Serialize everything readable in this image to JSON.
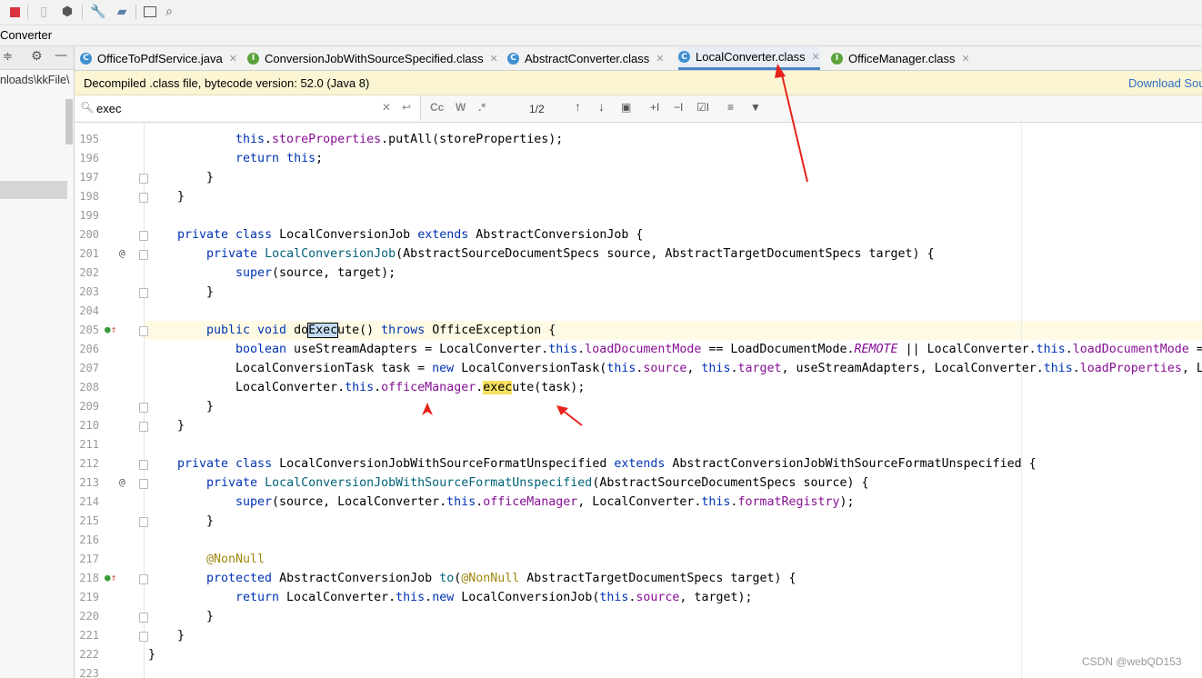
{
  "breadcrumb": "Converter",
  "left_panel": {
    "path_fragment": "nloads\\kkFile\\"
  },
  "tabs": [
    {
      "label": "OfficeToPdfService.java",
      "icon": "C",
      "icon_color": "#3f8fd1",
      "active": false
    },
    {
      "label": "ConversionJobWithSourceSpecified.class",
      "icon": "I",
      "icon_color": "#5aa33a",
      "active": false
    },
    {
      "label": "AbstractConverter.class",
      "icon": "C",
      "icon_color": "#3f8fd1",
      "active": false
    },
    {
      "label": "LocalConverter.class",
      "icon": "C",
      "icon_color": "#3f8fd1",
      "active": true
    },
    {
      "label": "OfficeManager.class",
      "icon": "I",
      "icon_color": "#5aa33a",
      "active": false
    }
  ],
  "banner": {
    "message": "Decompiled .class file, bytecode version: 52.0 (Java 8)",
    "link": "Download Sou"
  },
  "search": {
    "query": "exec",
    "match_count": "1/2",
    "case_label": "Cc",
    "word_label": "W",
    "regex_label": ".*"
  },
  "lines": [
    {
      "n": "195",
      "indent": 3,
      "parts": [
        [
          "kw",
          "this"
        ],
        [
          "",
          "."
        ],
        [
          "fld",
          "storeProperties"
        ],
        [
          "",
          ".putAll(storeProperties);"
        ]
      ]
    },
    {
      "n": "196",
      "indent": 3,
      "parts": [
        [
          "kw",
          "return"
        ],
        [
          "",
          " "
        ],
        [
          "kw",
          "this"
        ],
        [
          "",
          ";"
        ]
      ]
    },
    {
      "n": "197",
      "indent": 2,
      "parts": [
        [
          "",
          "}"
        ]
      ]
    },
    {
      "n": "198",
      "indent": 1,
      "parts": [
        [
          "",
          "}"
        ]
      ]
    },
    {
      "n": "199",
      "indent": 0,
      "parts": []
    },
    {
      "n": "200",
      "indent": 1,
      "parts": [
        [
          "kw",
          "private class"
        ],
        [
          "",
          " LocalConversionJob "
        ],
        [
          "kw",
          "extends"
        ],
        [
          "",
          " AbstractConversionJob {"
        ]
      ]
    },
    {
      "n": "201",
      "indent": 2,
      "parts": [
        [
          "kw",
          "private"
        ],
        [
          "",
          " "
        ],
        [
          "fn",
          "LocalConversionJob"
        ],
        [
          "",
          "(AbstractSourceDocumentSpecs source, AbstractTargetDocumentSpecs target) {"
        ]
      ]
    },
    {
      "n": "202",
      "indent": 3,
      "parts": [
        [
          "kw",
          "super"
        ],
        [
          "",
          "(source, target);"
        ]
      ]
    },
    {
      "n": "203",
      "indent": 2,
      "parts": [
        [
          "",
          "}"
        ]
      ]
    },
    {
      "n": "204",
      "indent": 0,
      "parts": []
    },
    {
      "n": "205",
      "indent": 2,
      "parts": [
        [
          "kw",
          "public void"
        ],
        [
          "",
          " do"
        ],
        [
          "cur",
          "Exec"
        ],
        [
          "",
          "ute() "
        ],
        [
          "kw",
          "throws"
        ],
        [
          "",
          " OfficeException {"
        ]
      ]
    },
    {
      "n": "206",
      "indent": 3,
      "parts": [
        [
          "kw",
          "boolean"
        ],
        [
          "",
          " useStreamAdapters = LocalConverter."
        ],
        [
          "kw",
          "this"
        ],
        [
          "",
          "."
        ],
        [
          "fld",
          "loadDocumentMode"
        ],
        [
          "",
          " == LoadDocumentMode."
        ],
        [
          "it",
          "REMOTE"
        ],
        [
          "",
          " || LocalConverter."
        ],
        [
          "kw",
          "this"
        ],
        [
          "",
          "."
        ],
        [
          "fld",
          "loadDocumentMode"
        ],
        [
          "",
          " ="
        ]
      ]
    },
    {
      "n": "207",
      "indent": 3,
      "parts": [
        [
          "",
          "LocalConversionTask task = "
        ],
        [
          "kw",
          "new"
        ],
        [
          "",
          " LocalConversionTask("
        ],
        [
          "kw",
          "this"
        ],
        [
          "",
          "."
        ],
        [
          "fld",
          "source"
        ],
        [
          "",
          ", "
        ],
        [
          "kw",
          "this"
        ],
        [
          "",
          "."
        ],
        [
          "fld",
          "target"
        ],
        [
          "",
          ", useStreamAdapters, LocalConverter."
        ],
        [
          "kw",
          "this"
        ],
        [
          "",
          "."
        ],
        [
          "fld",
          "loadProperties"
        ],
        [
          "",
          ", L"
        ]
      ]
    },
    {
      "n": "208",
      "indent": 3,
      "parts": [
        [
          "",
          "LocalConverter."
        ],
        [
          "kw",
          "this"
        ],
        [
          "",
          "."
        ],
        [
          "fld",
          "officeManager"
        ],
        [
          "",
          "."
        ],
        [
          "hl",
          "exec"
        ],
        [
          "",
          "ute(task);"
        ]
      ]
    },
    {
      "n": "209",
      "indent": 2,
      "parts": [
        [
          "",
          "}"
        ]
      ]
    },
    {
      "n": "210",
      "indent": 1,
      "parts": [
        [
          "",
          "}"
        ]
      ]
    },
    {
      "n": "211",
      "indent": 0,
      "parts": []
    },
    {
      "n": "212",
      "indent": 1,
      "parts": [
        [
          "kw",
          "private class"
        ],
        [
          "",
          " LocalConversionJobWithSourceFormatUnspecified "
        ],
        [
          "kw",
          "extends"
        ],
        [
          "",
          " AbstractConversionJobWithSourceFormatUnspecified {"
        ]
      ]
    },
    {
      "n": "213",
      "indent": 2,
      "parts": [
        [
          "kw",
          "private"
        ],
        [
          "",
          " "
        ],
        [
          "fn",
          "LocalConversionJobWithSourceFormatUnspecified"
        ],
        [
          "",
          "(AbstractSourceDocumentSpecs source) {"
        ]
      ]
    },
    {
      "n": "214",
      "indent": 3,
      "parts": [
        [
          "kw",
          "super"
        ],
        [
          "",
          "(source, LocalConverter."
        ],
        [
          "kw",
          "this"
        ],
        [
          "",
          "."
        ],
        [
          "fld",
          "officeManager"
        ],
        [
          "",
          ", LocalConverter."
        ],
        [
          "kw",
          "this"
        ],
        [
          "",
          "."
        ],
        [
          "fld",
          "formatRegistry"
        ],
        [
          "",
          ");"
        ]
      ]
    },
    {
      "n": "215",
      "indent": 2,
      "parts": [
        [
          "",
          "}"
        ]
      ]
    },
    {
      "n": "216",
      "indent": 0,
      "parts": []
    },
    {
      "n": "217",
      "indent": 2,
      "parts": [
        [
          "ann",
          "@NonNull"
        ]
      ]
    },
    {
      "n": "218",
      "indent": 2,
      "parts": [
        [
          "kw",
          "protected"
        ],
        [
          "",
          " AbstractConversionJob "
        ],
        [
          "fn",
          "to"
        ],
        [
          "",
          "("
        ],
        [
          "ann",
          "@NonNull"
        ],
        [
          "",
          " AbstractTargetDocumentSpecs target) {"
        ]
      ]
    },
    {
      "n": "219",
      "indent": 3,
      "parts": [
        [
          "kw",
          "return"
        ],
        [
          "",
          " LocalConverter."
        ],
        [
          "kw",
          "this"
        ],
        [
          "",
          "."
        ],
        [
          "kw",
          "new"
        ],
        [
          "",
          " LocalConversionJob("
        ],
        [
          "kw",
          "this"
        ],
        [
          "",
          "."
        ],
        [
          "fld",
          "source"
        ],
        [
          "",
          ", target);"
        ]
      ]
    },
    {
      "n": "220",
      "indent": 2,
      "parts": [
        [
          "",
          "}"
        ]
      ]
    },
    {
      "n": "221",
      "indent": 1,
      "parts": [
        [
          "",
          "}"
        ]
      ]
    },
    {
      "n": "222",
      "indent": 0,
      "parts": [
        [
          "",
          "}"
        ]
      ]
    },
    {
      "n": "223",
      "indent": 0,
      "parts": []
    }
  ],
  "current_line": "205",
  "gutter_marks": {
    "201": "@",
    "213": "@",
    "205": "override-up-icon",
    "218": "override-up-icon"
  },
  "watermark": "CSDN @webQD153",
  "colors": {
    "annotation_arrow": "#e8231c",
    "tab_active_underline": "#4a88c7",
    "keyword": "#0033b3",
    "field": "#871094"
  }
}
